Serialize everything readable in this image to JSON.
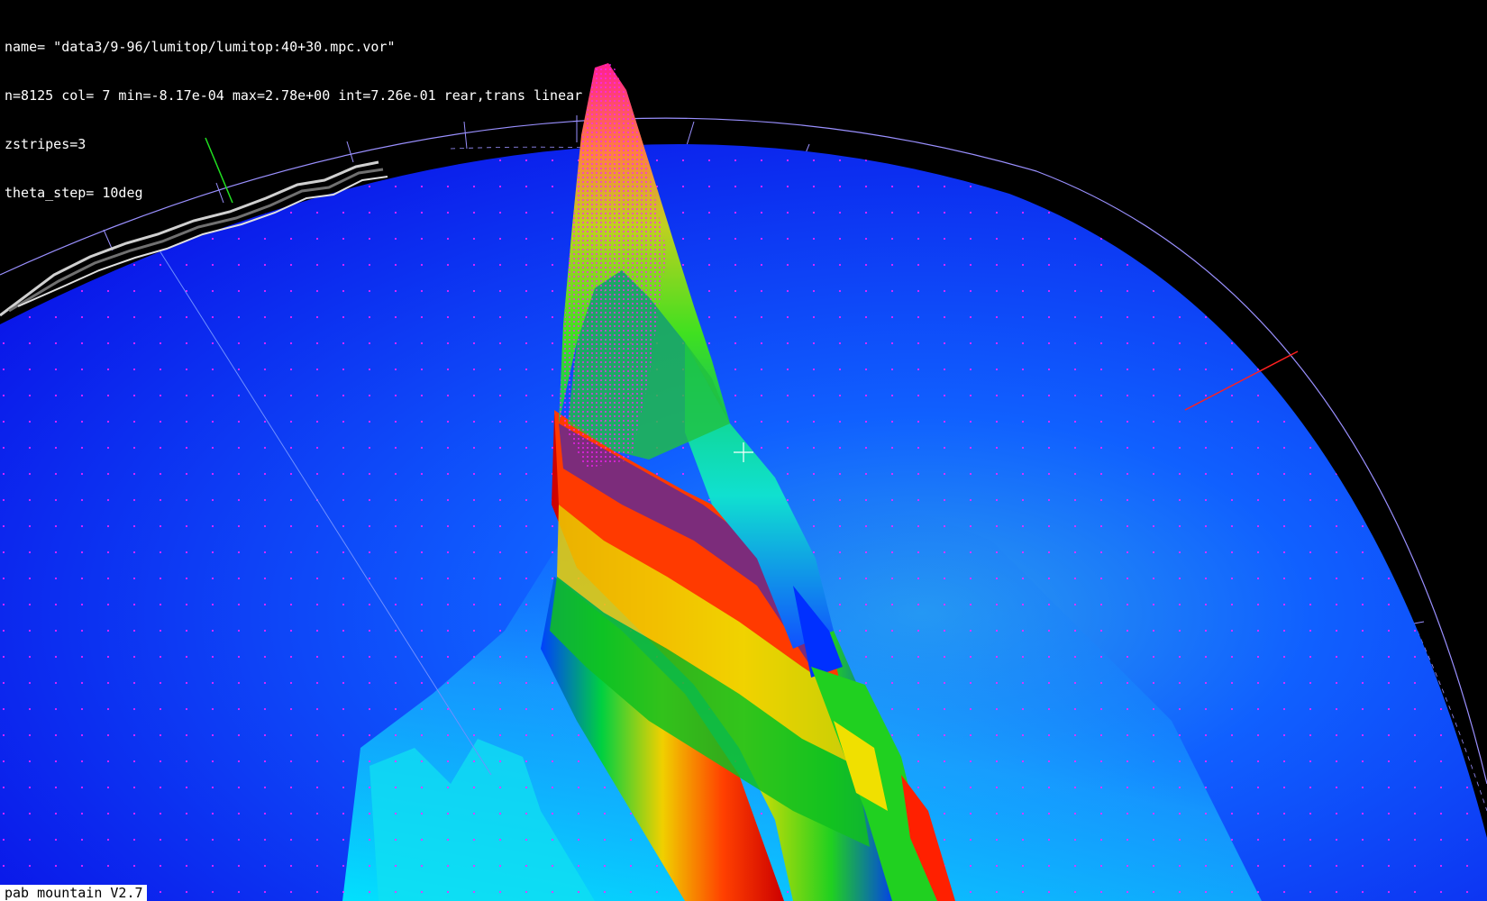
{
  "app": {
    "version_label": "pab mountain V2.7"
  },
  "info": {
    "name_line": "name= \"data3/9-96/lumitop/lumitop:40+30.mpc.vor\"",
    "stats_line": "n=8125 col= 7 min=-8.17e-04 max=2.78e+00 int=7.26e-01 rear,trans linear",
    "zstripes_line": "zstripes=3",
    "theta_line": "theta_step= 10deg"
  },
  "colors": {
    "background": "#000000",
    "floor": "#0a1ef0",
    "ring": "#9a90ff",
    "marker": "#ff22ff",
    "axis_x": "#ff2020",
    "axis_y": "#20e020",
    "text": "#ffffff"
  },
  "scene": {
    "theta_step_deg": 10,
    "zstripes": 3
  }
}
